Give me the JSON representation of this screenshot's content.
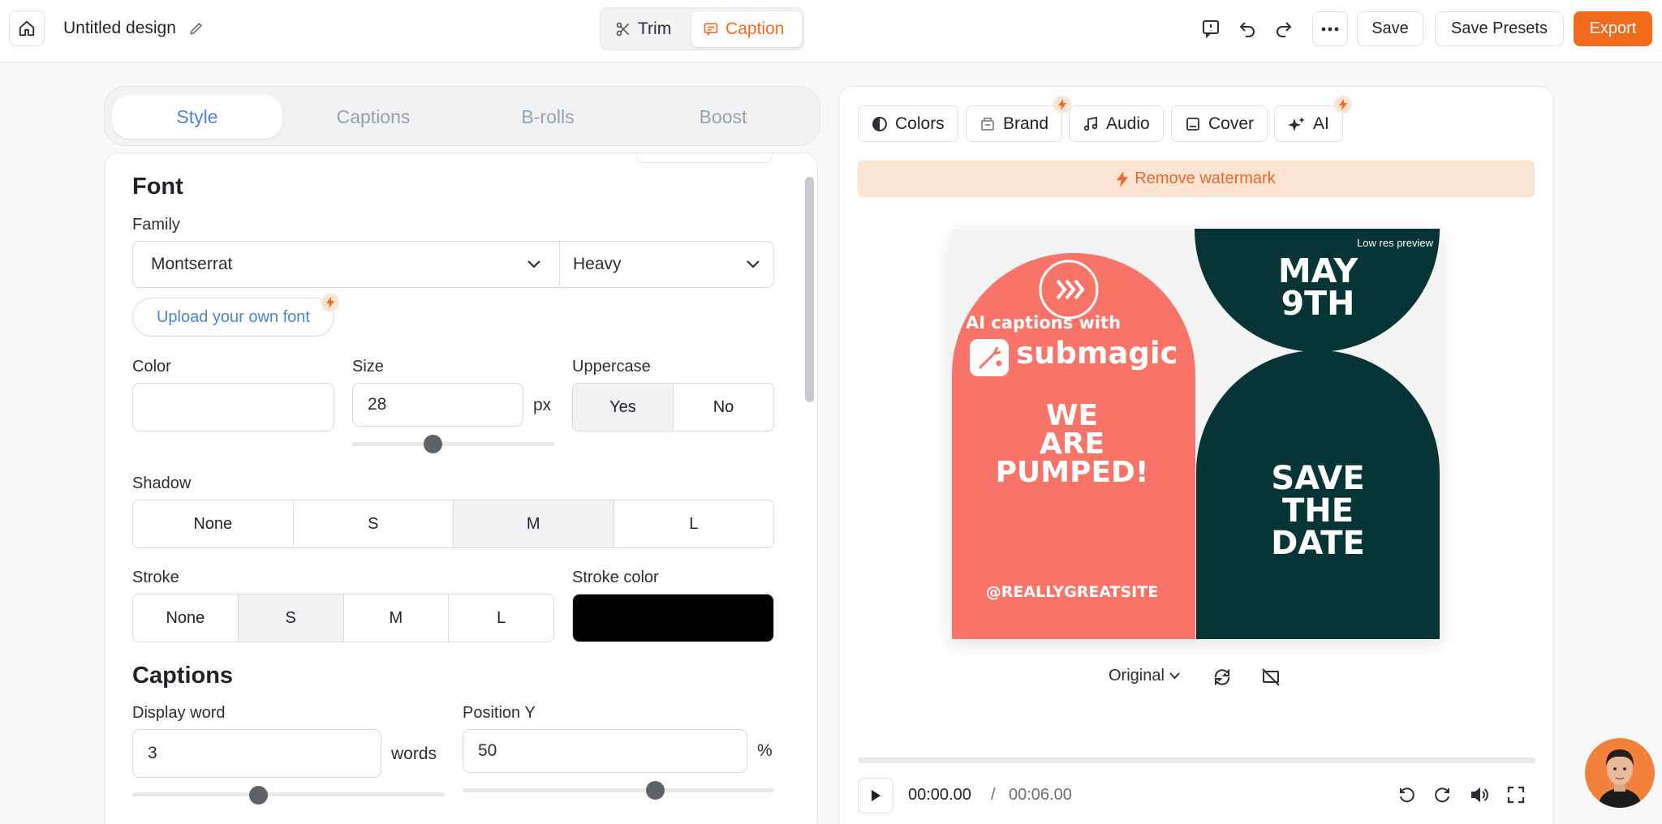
{
  "topbar": {
    "title": "Untitled design",
    "modes": {
      "trim": "Trim",
      "caption": "Caption"
    },
    "save": "Save",
    "save_presets": "Save Presets",
    "export": "Export"
  },
  "tabs": [
    "Style",
    "Captions",
    "B-rolls",
    "Boost"
  ],
  "font": {
    "heading": "Font",
    "family_label": "Family",
    "family": "Montserrat",
    "weight": "Heavy",
    "upload": "Upload your own font",
    "color_label": "Color",
    "size_label": "Size",
    "size": "28",
    "size_unit": "px",
    "uppercase_label": "Uppercase",
    "uppercase_yes": "Yes",
    "uppercase_no": "No",
    "shadow_label": "Shadow",
    "shadow_options": [
      "None",
      "S",
      "M",
      "L"
    ],
    "shadow_selected": "M",
    "stroke_label": "Stroke",
    "stroke_options": [
      "None",
      "S",
      "M",
      "L"
    ],
    "stroke_selected": "S",
    "stroke_color_label": "Stroke color"
  },
  "captions": {
    "heading": "Captions",
    "display_word_label": "Display word",
    "display_word": "3",
    "display_word_unit": "words",
    "position_y_label": "Position Y",
    "position_y": "50",
    "position_y_unit": "%"
  },
  "right": {
    "tools": [
      "Colors",
      "Brand",
      "Audio",
      "Cover",
      "AI"
    ],
    "remove_watermark": "Remove watermark",
    "preview": {
      "low_res": "Low res preview",
      "ai_captions": "AI captions with",
      "brand": "submagic",
      "pumped": [
        "WE",
        "ARE",
        "PUMPED!"
      ],
      "handle": "@REALLYGREATSITE",
      "date": [
        "MAY",
        "9TH"
      ],
      "save": [
        "SAVE",
        "THE",
        "DATE"
      ]
    },
    "aspect": "Original",
    "current_time": "00:00.00",
    "time_sep": "/",
    "duration": "00:06.00"
  },
  "colors": {
    "accent": "#f26a1b",
    "tab_active": "#4a86d6",
    "salmon": "#f87468",
    "dark_green": "#073436"
  }
}
